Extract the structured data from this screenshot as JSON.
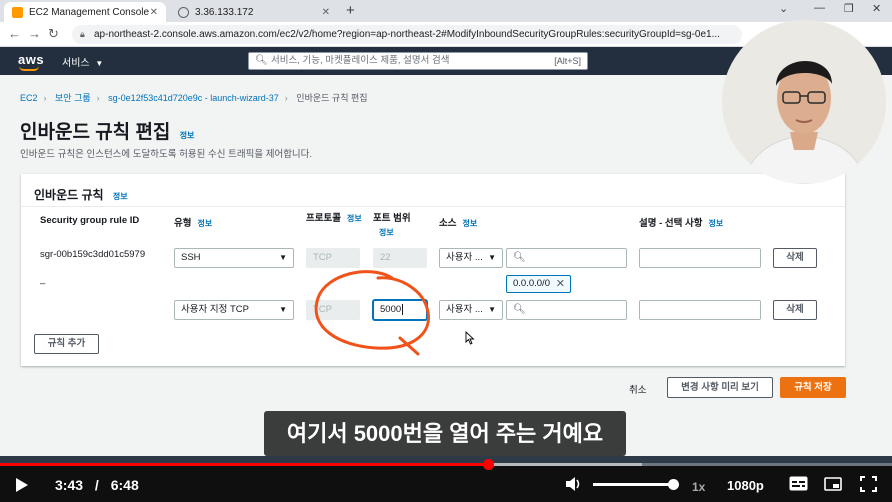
{
  "browser": {
    "tabs": [
      {
        "label": "EC2 Management Console",
        "active": true
      },
      {
        "label": "3.36.133.172",
        "active": false
      }
    ],
    "url": "ap-northeast-2.console.aws.amazon.com/ec2/v2/home?region=ap-northeast-2#ModifyInboundSecurityGroupRules:securityGroupId=sg-0e1..."
  },
  "aws_nav": {
    "logo": "aws",
    "services_label": "서비스",
    "search_placeholder": "서비스, 기능, 마켓플레이스 제품, 설명서 검색",
    "search_shortcut": "[Alt+S]"
  },
  "breadcrumb": {
    "items": [
      "EC2",
      "보안 그룹",
      "sg-0e12f53c41d720e9c - launch-wizard-37",
      "인바운드 규칙 편집"
    ]
  },
  "page": {
    "title": "인바운드 규칙 편집",
    "info_label": "정보",
    "description": "인바운드 규칙은 인스턴스에 도달하도록 허용된 수신 트래픽을 제어합니다."
  },
  "panel": {
    "heading": "인바운드 규칙",
    "info_label": "정보",
    "columns": {
      "rule_id": "Security group rule ID",
      "type": "유형",
      "protocol": "프로토콜",
      "port_range": "포트 범위",
      "source": "소스",
      "description": "설명 - 선택 사항"
    },
    "rows": [
      {
        "rule_id": "sgr-00b159c3dd01c5979",
        "type": "SSH",
        "protocol": "TCP",
        "port_range": "22",
        "source": "사용자 ...",
        "cidr_token": "0.0.0.0/0",
        "delete_label": "삭제"
      },
      {
        "rule_id": "–",
        "type": "사용자 지정 TCP",
        "protocol": "TCP",
        "port_range": "5000",
        "source": "사용자 ...",
        "delete_label": "삭제"
      }
    ],
    "add_rule_label": "규칙 추가"
  },
  "footer": {
    "cancel": "취소",
    "preview": "변경 사항 미리 보기",
    "save": "규칙 저장"
  },
  "subtitle": "여기서 5000번을 열어 주는 거예요",
  "player": {
    "current_time": "3:43",
    "separator": "/",
    "duration": "6:48",
    "speed": "1x",
    "quality": "1080p",
    "progress_fraction": 0.547,
    "buffered_fraction": 0.72
  },
  "colors": {
    "aws_nav_bg": "#232f3e",
    "aws_accent": "#ff9900",
    "link": "#0073bb",
    "save_button": "#ec7211",
    "annotation_circle": "#f0521a",
    "progress": "#ff0000"
  }
}
